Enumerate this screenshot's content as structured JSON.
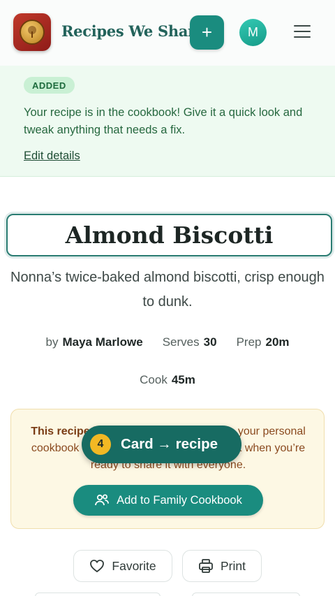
{
  "header": {
    "brand": "Recipes We Share",
    "add_icon": "plus-icon",
    "avatar_initial": "M",
    "menu_icon": "hamburger-icon"
  },
  "banner": {
    "badge": "ADDED",
    "message": "Your recipe is in the cookbook! Give it a quick look and tweak anything that needs a fix.",
    "link": "Edit details"
  },
  "recipe": {
    "title": "Almond Biscotti",
    "description": "Nonna’s twice-baked almond biscotti, crisp enough to dunk.",
    "by_label": "by",
    "author": "Maya Marlowe",
    "serves_label": "Serves",
    "serves": "30",
    "prep_label": "Prep",
    "prep": "20m",
    "cook_label": "Cook",
    "cook": "45m"
  },
  "notice": {
    "strong": "This recipe is only visible to you.",
    "text": " It’s in your personal cookbook — add it to the Family cookbook when you’re ready to share it with everyone.",
    "button": "Add to Family Cookbook",
    "button_icon": "users-icon"
  },
  "tooltip": {
    "number": "4",
    "label": "Card → recipe"
  },
  "actions": {
    "favorite": "Favorite",
    "favorite_icon": "heart-icon",
    "print": "Print",
    "print_icon": "printer-icon"
  },
  "colors": {
    "accent": "#1a8c7f",
    "brand_text": "#23635b",
    "banner_bg": "#eefaf1",
    "notice_bg": "#fdf8e4",
    "tooltip_badge": "#f2b824"
  }
}
